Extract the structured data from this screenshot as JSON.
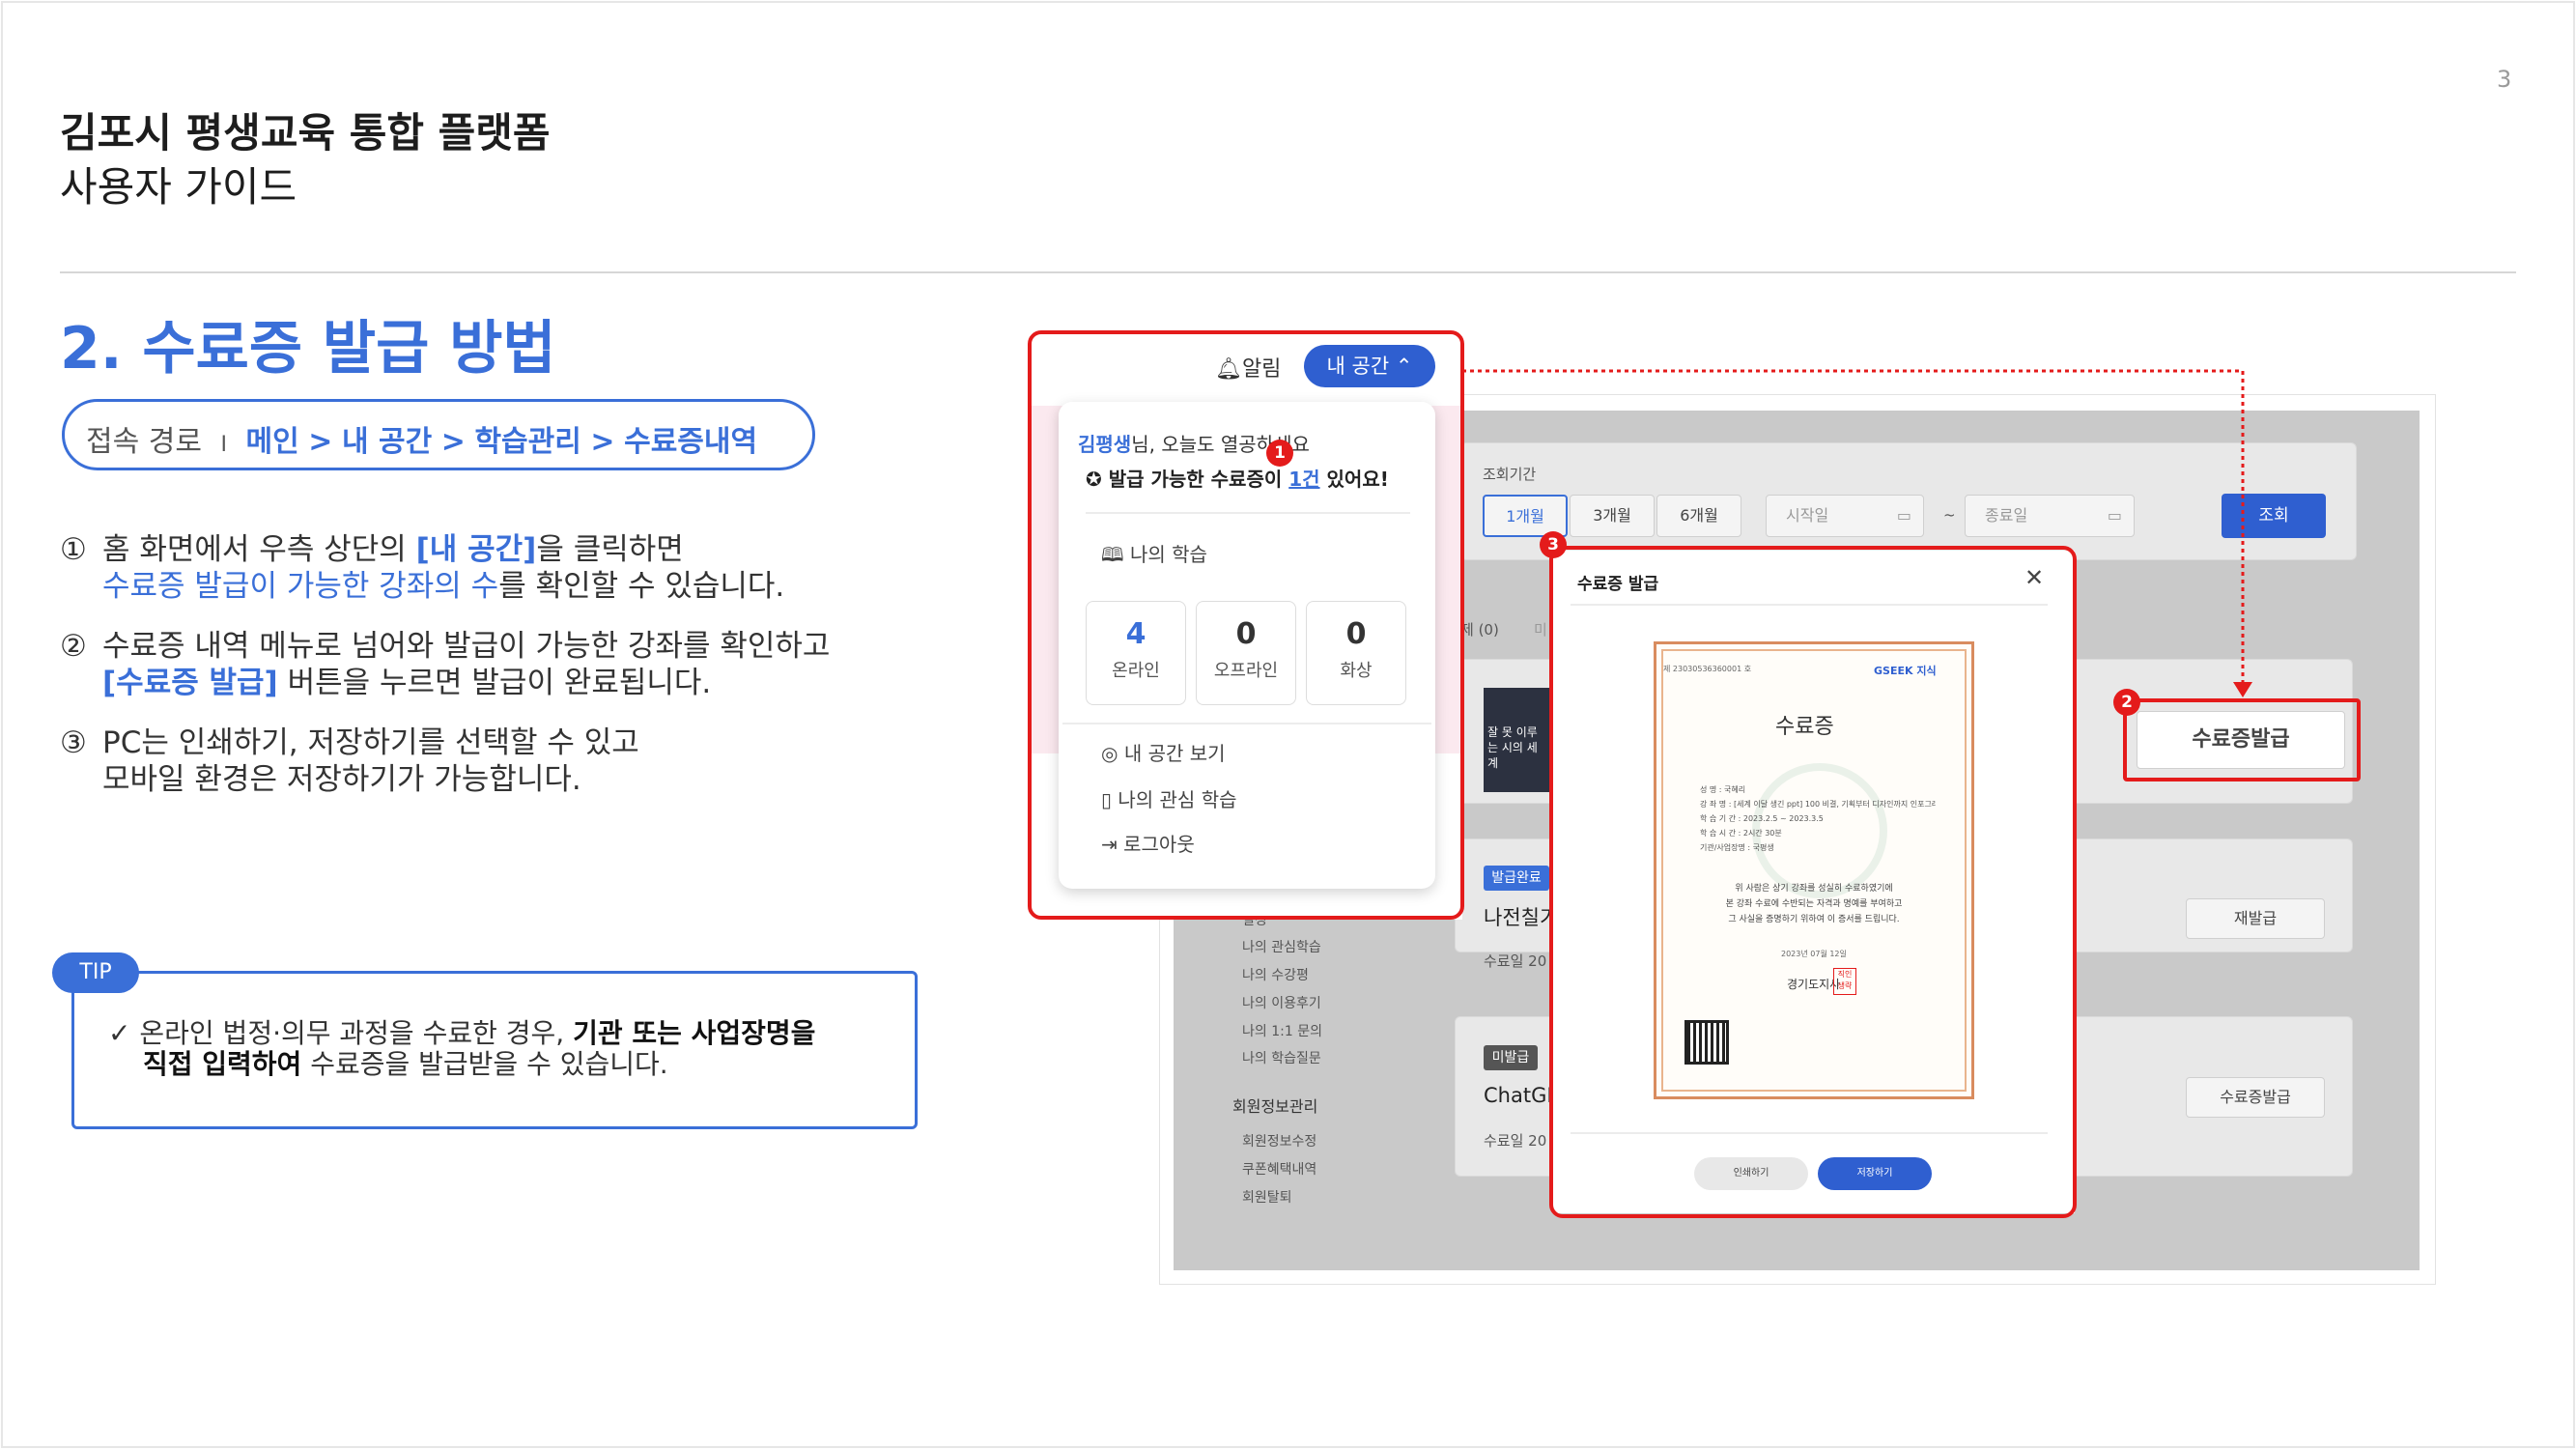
{
  "page": {
    "number": "3",
    "title": "김포시 평생교육 통합 플랫폼",
    "subtitle": "사용자 가이드",
    "section": "2. 수료증 발급 방법"
  },
  "access_path": {
    "label": "접속 경로",
    "separator": "I",
    "crumbs": [
      "메인",
      ">",
      "내 공간",
      ">",
      "학습관리",
      ">",
      "수료증내역"
    ]
  },
  "steps": [
    {
      "num": "①",
      "l1a": "홈 화면에서 우측 상단의 ",
      "l1b": "[내 공간]",
      "l1c": "을 클릭하면",
      "l2a": "수료증 발급이 가능한 강좌의 수",
      "l2b": "를 확인할 수 있습니다."
    },
    {
      "num": "②",
      "l1": "수료증 내역 메뉴로 넘어와 발급이 가능한 강좌를 확인하고",
      "l2a": "[수료증 발급]",
      "l2b": " 버튼을 누르면 발급이 완료됩니다."
    },
    {
      "num": "③",
      "l1": "PC는 인쇄하기, 저장하기를 선택할 수 있고",
      "l2": "모바일 환경은 저장하기가 가능합니다."
    }
  ],
  "tip": {
    "tag": "TIP",
    "check": "✓",
    "l1a": "온라인 법정·의무 과정을 수료한 경우, ",
    "l1b": "기관 또는 사업장명을",
    "l2a": "직접 입력하여",
    "l2b": " 수료증을 발급받을 수 있습니다."
  },
  "screen": {
    "period_label": "조회기간",
    "period_tabs": [
      "1개월",
      "3개월",
      "6개월"
    ],
    "start_placeholder": "시작일",
    "end_placeholder": "종료일",
    "dash": "~",
    "search_btn": "조회",
    "list_tab": "제 (0)",
    "list_tab2": "미",
    "side_menu": [
      "일정",
      "나의 관심학습",
      "나의 수강평",
      "나의 이용후기",
      "나의 1:1 문의",
      "나의 학습질문"
    ],
    "member_section": "회원정보관리",
    "member_menu": [
      "회원정보수정",
      "쿠폰혜택내역",
      "회원탈퇴"
    ],
    "course1_thumb": "잘 못 이루는 시의 세계",
    "course2_badge": "발급완료",
    "course2_title": "나전칠기",
    "course2_date": "수료일 20",
    "course2_btn": "재발급",
    "course3_badge": "미발급",
    "course3_title": "ChatGP",
    "course3_date": "수료일 20",
    "course3_btn": "수료증발급",
    "issue_btn": "수료증발급"
  },
  "popup": {
    "bell": "알림",
    "myspace_btn": "내 공간 ⌃",
    "user": "김평생",
    "greet": "님, 오늘도 열공하세요",
    "cert_msg_a": "발급 가능한 수료증이 ",
    "cert_msg_count": "1건",
    "cert_msg_b": " 있어요!",
    "my_learning": "나의 학습",
    "stats": [
      {
        "value": "4",
        "label": "온라인"
      },
      {
        "value": "0",
        "label": "오프라인"
      },
      {
        "value": "0",
        "label": "화상"
      }
    ],
    "menu": [
      "내 공간 보기",
      "나의 관심 학습",
      "로그아웃"
    ]
  },
  "modal": {
    "title": "수료증 발급",
    "close": "✕",
    "cert_no": "제 23030536360001 호",
    "cert_logo": "GSEEK 지식",
    "cert_title": "수료증",
    "cert_fields": [
      "성          명 : 국혜리",
      "강     좌     명 : [세계 이달 생긴 ppt] 100 비결, 기획부터 디자인까지 인포그래픽 가이드",
      "학 습 기 간 : 2023.2.5 ~ 2023.3.5",
      "학 습 시 간 : 2시간 30분",
      "기관/사업장명 : 국평생"
    ],
    "cert_body": [
      "위 사람은 상기 강좌를 성실히 수료하였기에",
      "본 강좌 수료에 수반되는 자격과 명예를 부여하고",
      "그 사실을 증명하기 위하여 이 증서를 드립니다."
    ],
    "cert_date": "2023년 07월 12일",
    "cert_issuer": "경기도지사",
    "cert_seal": "직인 생략",
    "print_btn": "인쇄하기",
    "save_btn": "저장하기"
  },
  "markers": [
    "1",
    "2",
    "3"
  ],
  "colors": {
    "accent": "#3a6fd8",
    "highlight": "#e41b1b",
    "button": "#2f5fd0"
  }
}
